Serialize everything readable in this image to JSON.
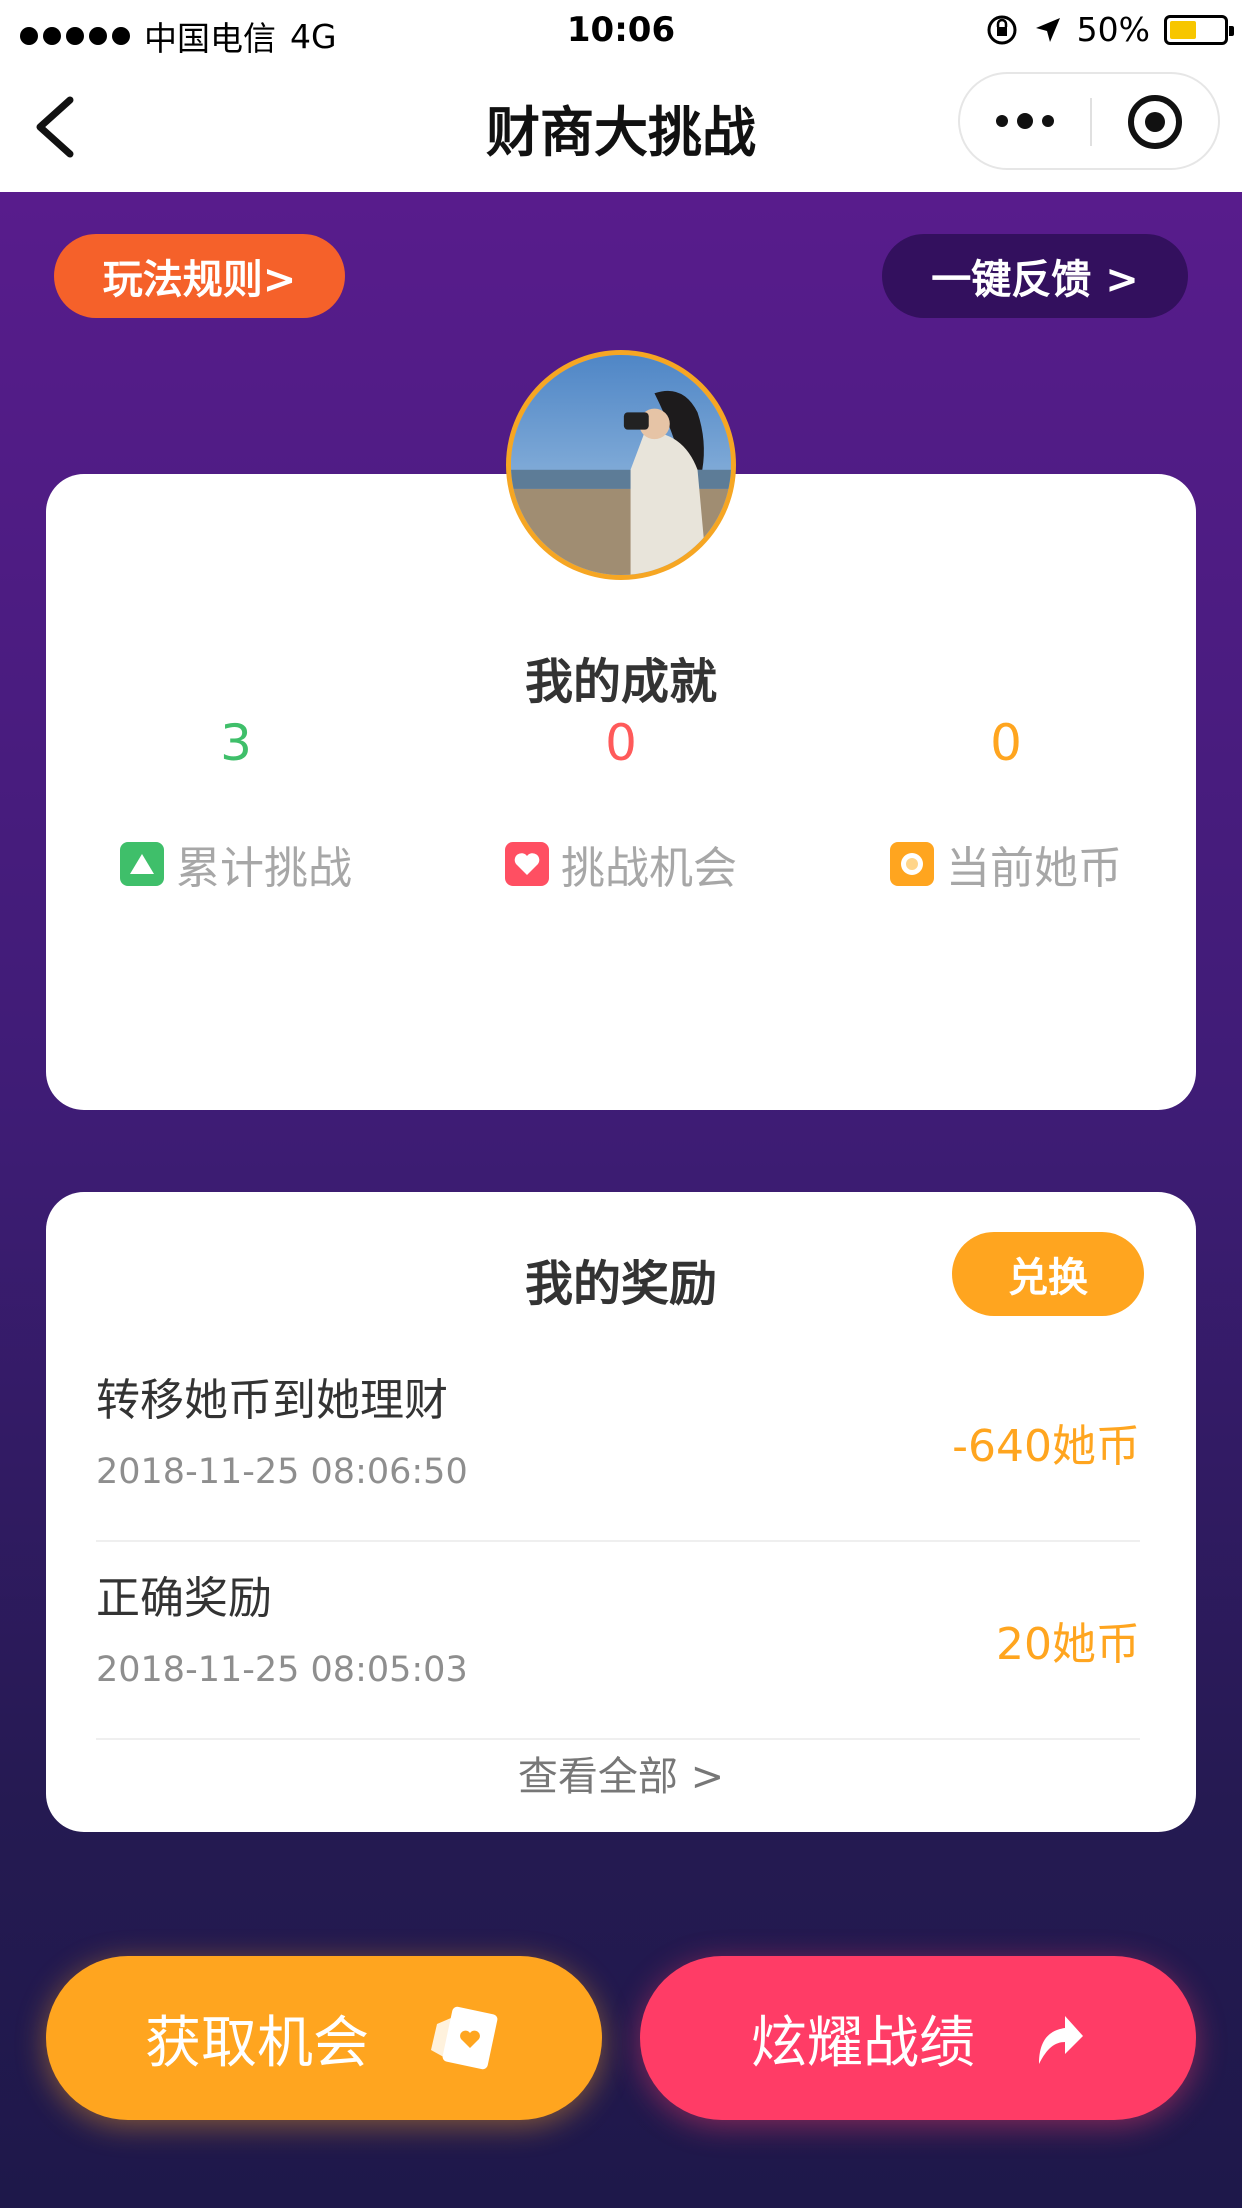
{
  "status_bar": {
    "carrier": "中国电信",
    "network": "4G",
    "time": "10:06",
    "battery": "50%"
  },
  "nav": {
    "title": "财商大挑战"
  },
  "top_buttons": {
    "rules": "玩法规则>",
    "feedback": "一键反馈 >"
  },
  "achievements": {
    "title": "我的成就",
    "stats": [
      {
        "value": "3",
        "label": "累计挑战",
        "color": "#3fbf6a",
        "icon": "triangle-icon"
      },
      {
        "value": "0",
        "label": "挑战机会",
        "color": "#ff5a5a",
        "icon": "heart-icon"
      },
      {
        "value": "0",
        "label": "当前她币",
        "color": "#ffa51f",
        "icon": "coin-icon"
      }
    ]
  },
  "rewards": {
    "title": "我的奖励",
    "exchange": "兑换",
    "items": [
      {
        "name": "转移她币到她理财",
        "date": "2018-11-25 08:06:50",
        "amount": "-640她币"
      },
      {
        "name": "正确奖励",
        "date": "2018-11-25 08:05:03",
        "amount": "20她币"
      }
    ],
    "view_all": "查看全部 >"
  },
  "actions": {
    "get_chance": "获取机会",
    "show_record": "炫耀战绩"
  }
}
